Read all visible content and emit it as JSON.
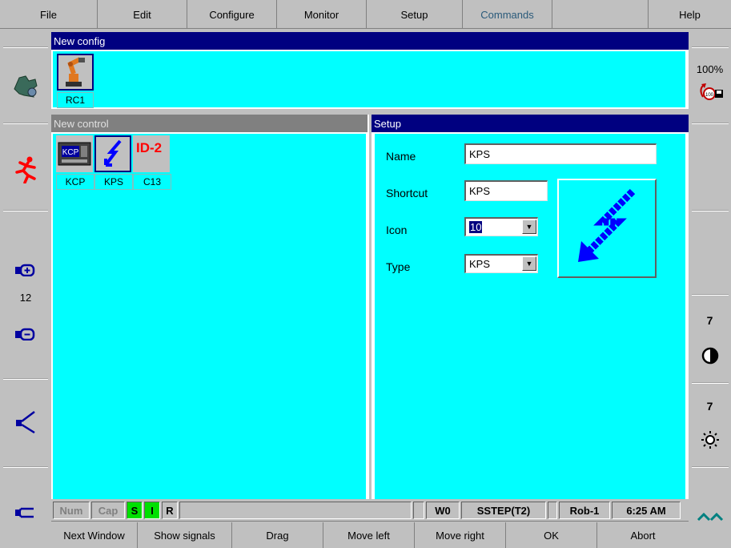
{
  "menu": {
    "items": [
      {
        "label": "File"
      },
      {
        "label": "Edit"
      },
      {
        "label": "Configure"
      },
      {
        "label": "Monitor"
      },
      {
        "label": "Setup"
      },
      {
        "label": "Commands",
        "active": true
      },
      {
        "label": ""
      },
      {
        "label": "Help"
      }
    ]
  },
  "left_panel": {
    "buttons": [
      {
        "icon": "robot-config-icon"
      },
      {
        "icon": "run-man-icon"
      },
      {
        "icon": "jog-plus-icon"
      },
      {
        "icon": "jog-minus-icon"
      },
      {
        "icon": "gripper-open-icon"
      },
      {
        "icon": "gripper-close-icon"
      }
    ],
    "value": "12"
  },
  "right_panel": {
    "override": "100%",
    "override_icon": "override-100-icon",
    "contrast_value": "7",
    "contrast_icon": "contrast-icon",
    "brightness_value": "7",
    "brightness_icon": "brightness-icon",
    "scroll_icon": "double-chevron-up-icon"
  },
  "config_window": {
    "title": "New config",
    "items": [
      {
        "label": "RC1",
        "icon": "robot-arm-icon"
      }
    ]
  },
  "control_window": {
    "title": "New control",
    "items": [
      {
        "label": "KCP",
        "icon": "kcp-icon",
        "badge": "KCP"
      },
      {
        "label": "KPS",
        "icon": "lightning-icon"
      },
      {
        "label": "C13",
        "icon": "id-2-icon",
        "badge": "ID-2"
      }
    ]
  },
  "setup_window": {
    "title": "Setup",
    "name_label": "Name",
    "name_value": "KPS",
    "shortcut_label": "Shortcut",
    "shortcut_value": "KPS",
    "icon_label": "Icon",
    "icon_value": "10",
    "type_label": "Type",
    "type_value": "KPS",
    "preview_icon": "lightning-arrow-icon"
  },
  "status_bar": {
    "num": "Num",
    "cap": "Cap",
    "s": "S",
    "i": "I",
    "r": "R",
    "w": "W0",
    "mode": "SSTEP(T2)",
    "robot": "Rob-1",
    "time": "6:25 AM"
  },
  "softkeys": [
    {
      "label": "Next Window"
    },
    {
      "label": "Show signals"
    },
    {
      "label": "Drag"
    },
    {
      "label": "Move left"
    },
    {
      "label": "Move right"
    },
    {
      "label": "OK"
    },
    {
      "label": "Abort"
    }
  ],
  "colors": {
    "workspace": "#00ffff",
    "active_title": "#000080",
    "inactive_title": "#808080"
  }
}
